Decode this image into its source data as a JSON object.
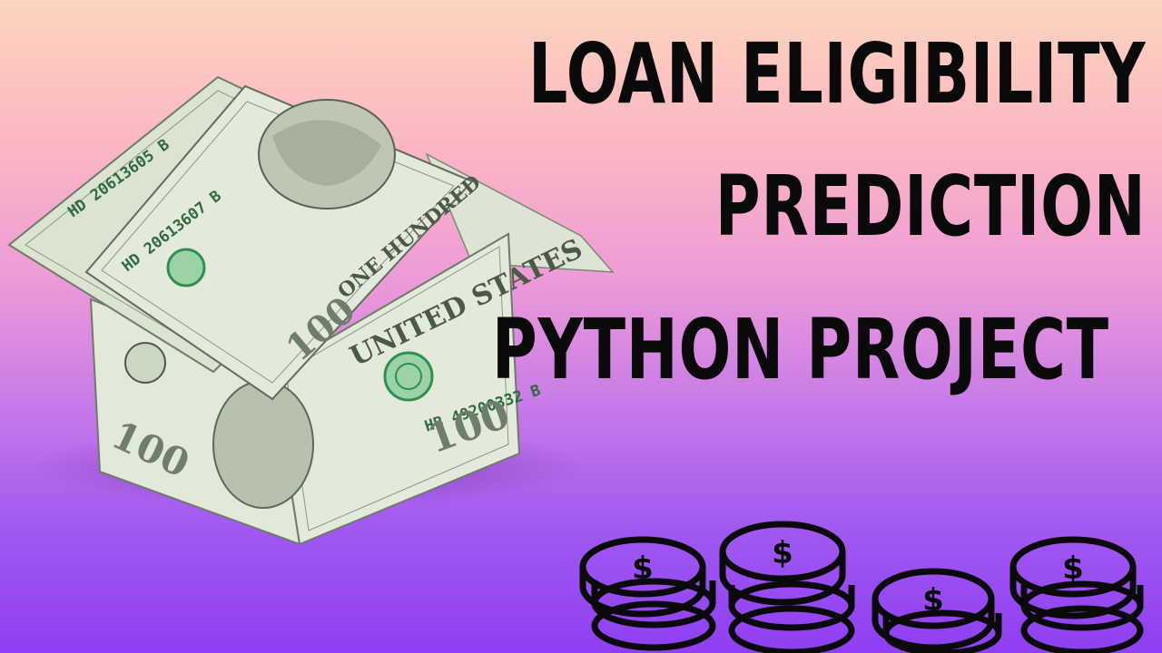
{
  "title": {
    "line1": "LOAN ELIGIBILITY",
    "line2": "PREDICTION",
    "line3": "PYTHON PROJECT"
  },
  "illustration": {
    "house": {
      "icon": "money-house-illustration",
      "banknote_serials": [
        "HD 20613605 B",
        "HD 20613607 B",
        "HB 49200332 B"
      ],
      "denomination": "100"
    },
    "coins": {
      "icon": "dollar-coin-stack-icon",
      "symbol": "$"
    }
  },
  "colors": {
    "gradient_top": "#fcd5bf",
    "gradient_mid": "#ef9bd8",
    "gradient_bottom": "#8e3ff2",
    "text": "#0a0a0a",
    "banknote": "#dfe6d4",
    "banknote_ink": "#4b5a46",
    "seal_green": "#2f8f4e"
  }
}
